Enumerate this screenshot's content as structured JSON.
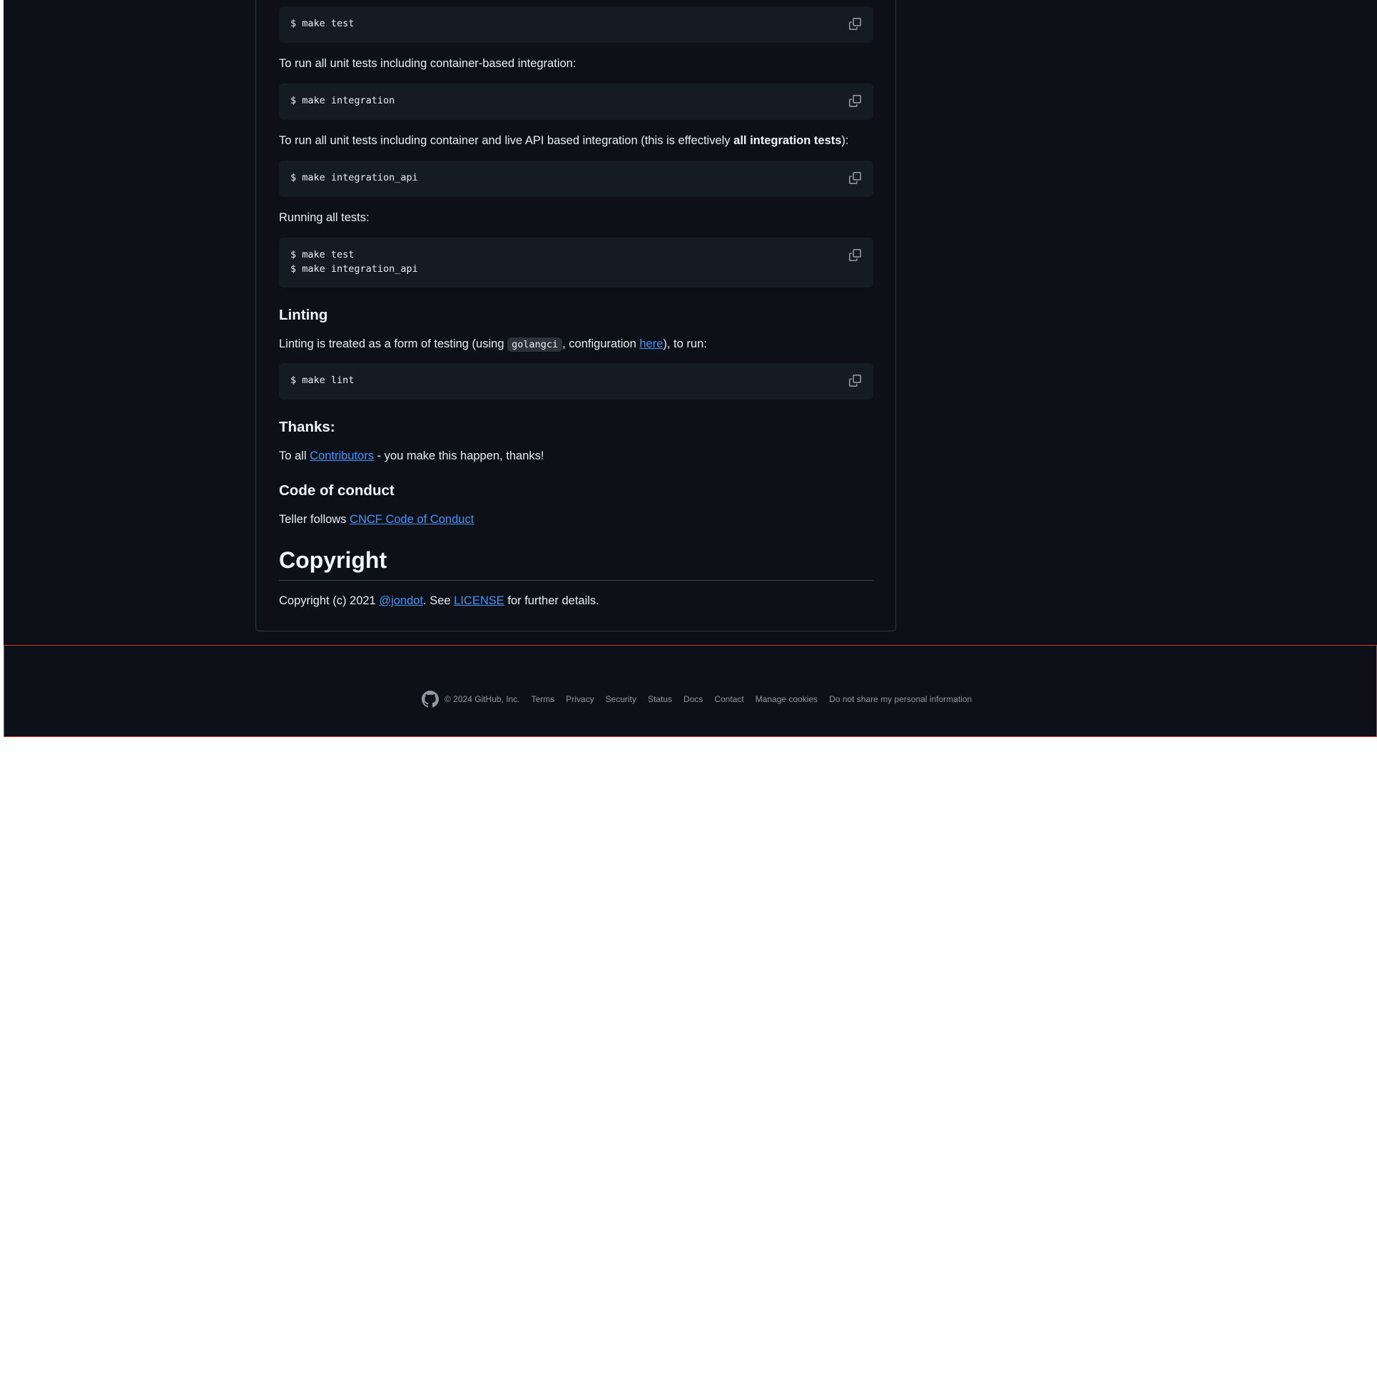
{
  "readme": {
    "code_make_test": "$ make test",
    "p_integration": "To run all unit tests including container-based integration:",
    "code_make_integration": "$ make integration",
    "p_integration_api_pre": "To run all unit tests including container and live API based integration (this is effectively ",
    "p_integration_api_bold": "all integration tests",
    "p_integration_api_post": "):",
    "code_make_integration_api": "$ make integration_api",
    "p_running_all": "Running all tests:",
    "code_all_tests": "$ make test\n$ make integration_api",
    "h_linting": "Linting",
    "p_linting_pre": "Linting is treated as a form of testing (using ",
    "p_linting_code": "golangci",
    "p_linting_mid": ", configuration ",
    "p_linting_link": "here",
    "p_linting_post": "), to run:",
    "code_make_lint": "$ make lint",
    "h_thanks": "Thanks:",
    "p_thanks_pre": "To all ",
    "p_thanks_link": "Contributors",
    "p_thanks_post": " - you make this happen, thanks!",
    "h_conduct": "Code of conduct",
    "p_conduct_pre": "Teller follows ",
    "p_conduct_link": "CNCF Code of Conduct",
    "h_copyright": "Copyright",
    "p_copyright_pre": "Copyright (c) 2021 ",
    "p_copyright_user": "@jondot",
    "p_copyright_mid": ". See ",
    "p_copyright_license": "LICENSE",
    "p_copyright_post": " for further details."
  },
  "footer": {
    "copyright": "© 2024 GitHub, Inc.",
    "links": [
      "Terms",
      "Privacy",
      "Security",
      "Status",
      "Docs",
      "Contact",
      "Manage cookies",
      "Do not share my personal information"
    ]
  },
  "icons": {
    "copy": "copy-icon",
    "github": "github-logo-icon"
  },
  "colors": {
    "background": "#0d1117",
    "code_background": "#151b23",
    "text": "#e6edf3",
    "link": "#4493f8",
    "muted": "#9198a1",
    "footer_border": "#da3633"
  }
}
